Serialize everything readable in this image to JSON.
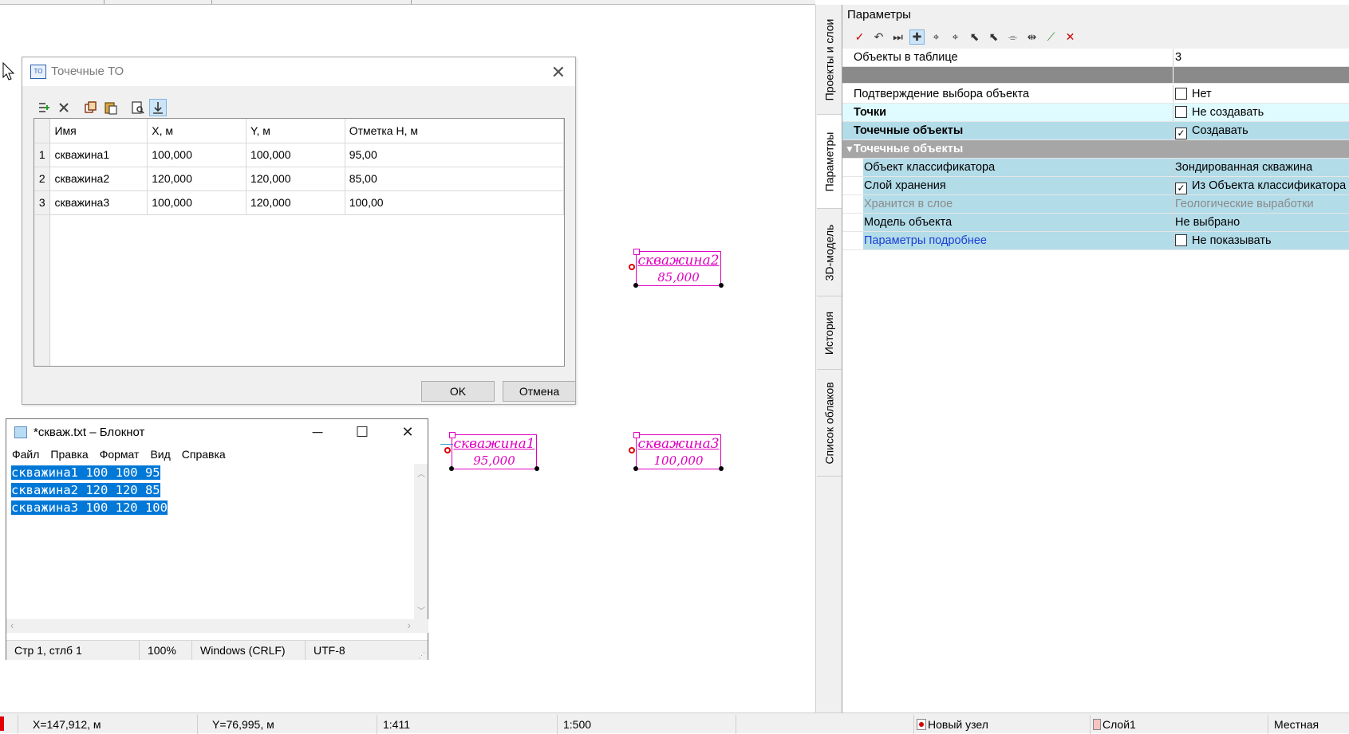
{
  "dialog": {
    "title": "Точечные ТО",
    "icon_text": "TO",
    "columns": [
      "Имя",
      "X, м",
      "Y, м",
      "Отметка H, м"
    ],
    "rows": [
      {
        "n": "1",
        "name": "скважина1",
        "x": "100,000",
        "y": "100,000",
        "h": "95,00"
      },
      {
        "n": "2",
        "name": "скважина2",
        "x": "120,000",
        "y": "120,000",
        "h": "85,00"
      },
      {
        "n": "3",
        "name": "скважина3",
        "x": "100,000",
        "y": "120,000",
        "h": "100,00"
      }
    ],
    "ok_label": "OK",
    "cancel_label": "Отмена"
  },
  "notepad": {
    "title": "*скваж.txt – Блокнот",
    "menu": [
      "Файл",
      "Правка",
      "Формат",
      "Вид",
      "Справка"
    ],
    "lines": [
      "скважина1 100 100 95",
      "скважина2 120 120 85",
      "скважина3 100 120 100"
    ],
    "status": {
      "pos": "Стр 1, стлб 1",
      "zoom": "100%",
      "eol": "Windows (CRLF)",
      "enc": "UTF-8"
    }
  },
  "map_labels": [
    {
      "name": "скважина2",
      "value": "85,000"
    },
    {
      "name": "скважина1",
      "value": "95,000"
    },
    {
      "name": "скважина3",
      "value": "100,000"
    }
  ],
  "side_tabs": [
    "Проекты и слои",
    "Параметры",
    "3D-модель",
    "История",
    "Список облаков"
  ],
  "params": {
    "title": "Параметры",
    "rows": {
      "objects_in_table": {
        "key": "Объекты в таблице",
        "value": "3"
      },
      "confirm": {
        "key": "Подтверждение выбора объекта",
        "value": "Нет"
      },
      "points": {
        "key": "Точки",
        "value": "Не создавать"
      },
      "point_objects": {
        "key": "Точечные объекты",
        "value": "Создавать"
      },
      "group": {
        "key": "Точечные объекты"
      },
      "classifier": {
        "key": "Объект классификатора",
        "value": "Зондированная скважина"
      },
      "storage_layer": {
        "key": "Слой хранения",
        "value": "Из Объекта классификатора"
      },
      "stored_in": {
        "key": "Хранится в слое",
        "value": "Геологические выработки"
      },
      "model": {
        "key": "Модель объекта",
        "value": "Не выбрано"
      },
      "details": {
        "key": "Параметры подробнее",
        "value": "Не показывать"
      }
    }
  },
  "status": {
    "x": "X=147,912, м",
    "y": "Y=76,995, м",
    "scale1": "1:411",
    "scale2": "1:500",
    "node": "Новый узел",
    "layer": "Слой1",
    "cs": "Местная"
  },
  "colors": {
    "magenta": "#e000c0",
    "selection": "#0078d7",
    "group_header": "#a6a6a6",
    "row_highlight": "#b3dce9"
  }
}
